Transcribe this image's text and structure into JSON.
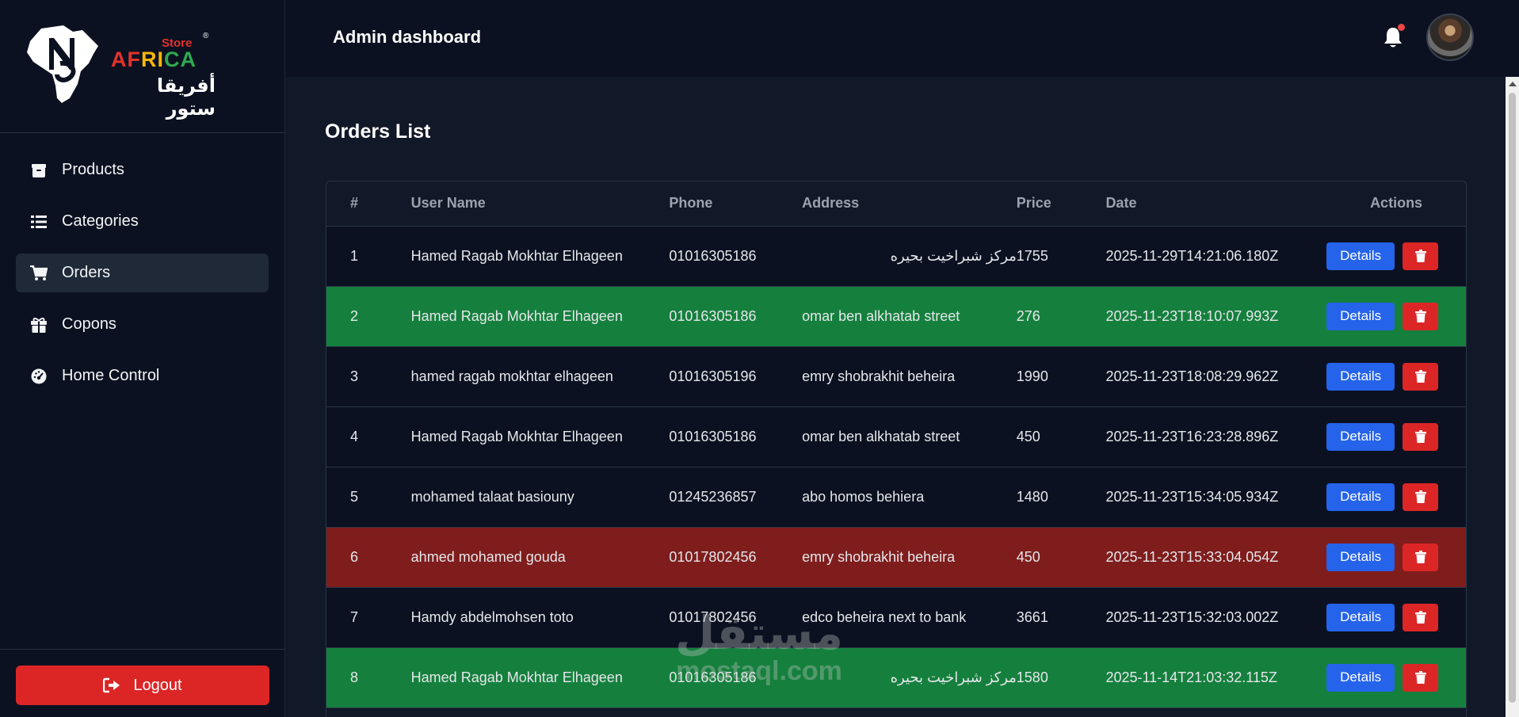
{
  "brand": {
    "store": "Store",
    "reg": "®",
    "africa_letters": [
      {
        "ch": "A",
        "color": "#e5312b"
      },
      {
        "ch": "F",
        "color": "#e5312b"
      },
      {
        "ch": "R",
        "color": "#f5b70a"
      },
      {
        "ch": "I",
        "color": "#f5b70a"
      },
      {
        "ch": "C",
        "color": "#2fa84f"
      },
      {
        "ch": "A",
        "color": "#2fa84f"
      }
    ],
    "arabic": "أفريقا ستور"
  },
  "sidebar": {
    "items": [
      {
        "label": "Products",
        "icon": "box-icon",
        "active": false
      },
      {
        "label": "Categories",
        "icon": "list-icon",
        "active": false
      },
      {
        "label": "Orders",
        "icon": "cart-icon",
        "active": true
      },
      {
        "label": "Copons",
        "icon": "gift-icon",
        "active": false
      },
      {
        "label": "Home Control",
        "icon": "gauge-icon",
        "active": false
      }
    ],
    "logout_label": "Logout"
  },
  "header": {
    "title": "Admin dashboard"
  },
  "main": {
    "title": "Orders List",
    "columns": [
      "#",
      "User Name",
      "Phone",
      "Address",
      "Price",
      "Date",
      "Actions"
    ],
    "details_label": "Details",
    "rows": [
      {
        "num": "1",
        "user": "Hamed Ragab Mokhtar Elhageen",
        "phone": "01016305186",
        "address": "مركز شبراخيت بحيره",
        "price": "1755",
        "date": "2025-11-29T14:21:06.180Z",
        "status": "default"
      },
      {
        "num": "2",
        "user": "Hamed Ragab Mokhtar Elhageen",
        "phone": "01016305186",
        "address": "omar ben alkhatab street",
        "price": "276",
        "date": "2025-11-23T18:10:07.993Z",
        "status": "green"
      },
      {
        "num": "3",
        "user": "hamed ragab mokhtar elhageen",
        "phone": "01016305196",
        "address": "emry shobrakhit beheira",
        "price": "1990",
        "date": "2025-11-23T18:08:29.962Z",
        "status": "default"
      },
      {
        "num": "4",
        "user": "Hamed Ragab Mokhtar Elhageen",
        "phone": "01016305186",
        "address": "omar ben alkhatab street",
        "price": "450",
        "date": "2025-11-23T16:23:28.896Z",
        "status": "default"
      },
      {
        "num": "5",
        "user": "mohamed talaat basiouny",
        "phone": "01245236857",
        "address": "abo homos behiera",
        "price": "1480",
        "date": "2025-11-23T15:34:05.934Z",
        "status": "default"
      },
      {
        "num": "6",
        "user": "ahmed mohamed gouda",
        "phone": "01017802456",
        "address": "emry shobrakhit beheira",
        "price": "450",
        "date": "2025-11-23T15:33:04.054Z",
        "status": "red"
      },
      {
        "num": "7",
        "user": "Hamdy abdelmohsen toto",
        "phone": "01017802456",
        "address": "edco beheira next to bank",
        "price": "3661",
        "date": "2025-11-23T15:32:03.002Z",
        "status": "default"
      },
      {
        "num": "8",
        "user": "Hamed Ragab Mokhtar Elhageen",
        "phone": "01016305186",
        "address": "مركز شبراخيت بحيره",
        "price": "1580",
        "date": "2025-11-14T21:03:32.115Z",
        "status": "green"
      }
    ]
  },
  "watermark": {
    "arabic": "مستقل",
    "latin": "mostaql.com"
  },
  "colors": {
    "accent_blue": "#2563eb",
    "danger_red": "#dc2626",
    "row_green": "#15803d",
    "row_red": "#7f1d1d"
  }
}
